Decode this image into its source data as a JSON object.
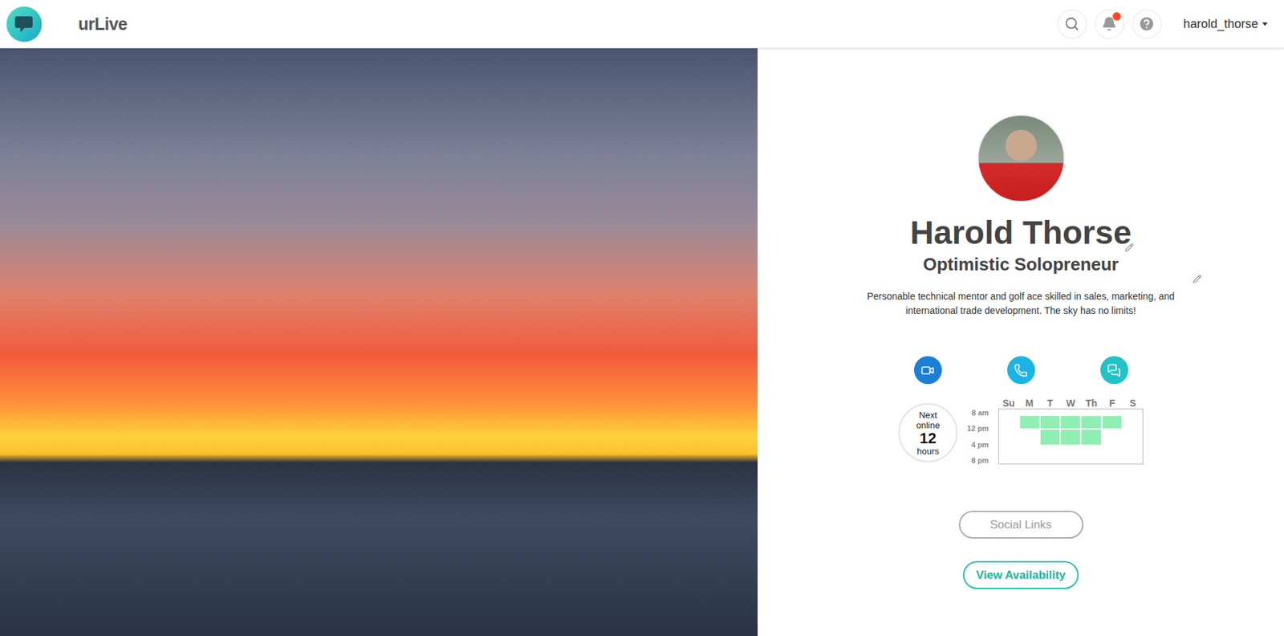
{
  "header": {
    "logo": "urLive",
    "notifications": {
      "unread": true
    },
    "user_menu": {
      "label": "harold_thorse"
    }
  },
  "profile": {
    "name": "Harold Thorse",
    "title": "Optimistic Solopreneur",
    "bio": "Personable technical mentor and golf ace skilled in sales, marketing, and international trade development. The sky has no limits!"
  },
  "contact_buttons": [
    {
      "kind": "video",
      "color": "#1a7fd6"
    },
    {
      "kind": "phone",
      "color": "#1cb4e6"
    },
    {
      "kind": "chat",
      "color": "#20c3c6"
    }
  ],
  "next_online": {
    "label": "Next online",
    "value": "12",
    "unit": "hours"
  },
  "schedule": {
    "times": [
      "8 am",
      "12 pm",
      "4 pm",
      "8 pm"
    ],
    "days": [
      {
        "label": "Su",
        "slots": [
          false,
          false,
          false,
          false
        ]
      },
      {
        "label": "M",
        "slots": [
          false,
          true,
          false,
          false
        ]
      },
      {
        "label": "T",
        "slots": [
          false,
          true,
          true,
          false
        ]
      },
      {
        "label": "W",
        "slots": [
          false,
          true,
          true,
          false
        ]
      },
      {
        "label": "Th",
        "slots": [
          false,
          true,
          true,
          false
        ]
      },
      {
        "label": "F",
        "slots": [
          false,
          true,
          false,
          false
        ]
      },
      {
        "label": "S",
        "slots": [
          false,
          false,
          false,
          false
        ]
      }
    ]
  },
  "buttons": [
    {
      "label": "Social Links",
      "kind": "secondary"
    },
    {
      "label": "View Availability",
      "kind": "primary"
    }
  ]
}
